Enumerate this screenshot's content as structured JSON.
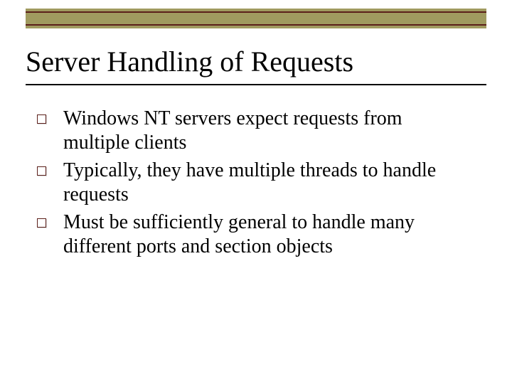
{
  "slide": {
    "title": "Server Handling of Requests",
    "accent_bar_color": "#a09a5f",
    "rule_color": "#5b1f1a",
    "bullets": [
      {
        "text": "Windows NT servers expect requests from multiple clients"
      },
      {
        "text": "Typically, they have multiple threads to handle requests"
      },
      {
        "text": "Must be sufficiently general to handle many different ports and section objects"
      }
    ]
  }
}
